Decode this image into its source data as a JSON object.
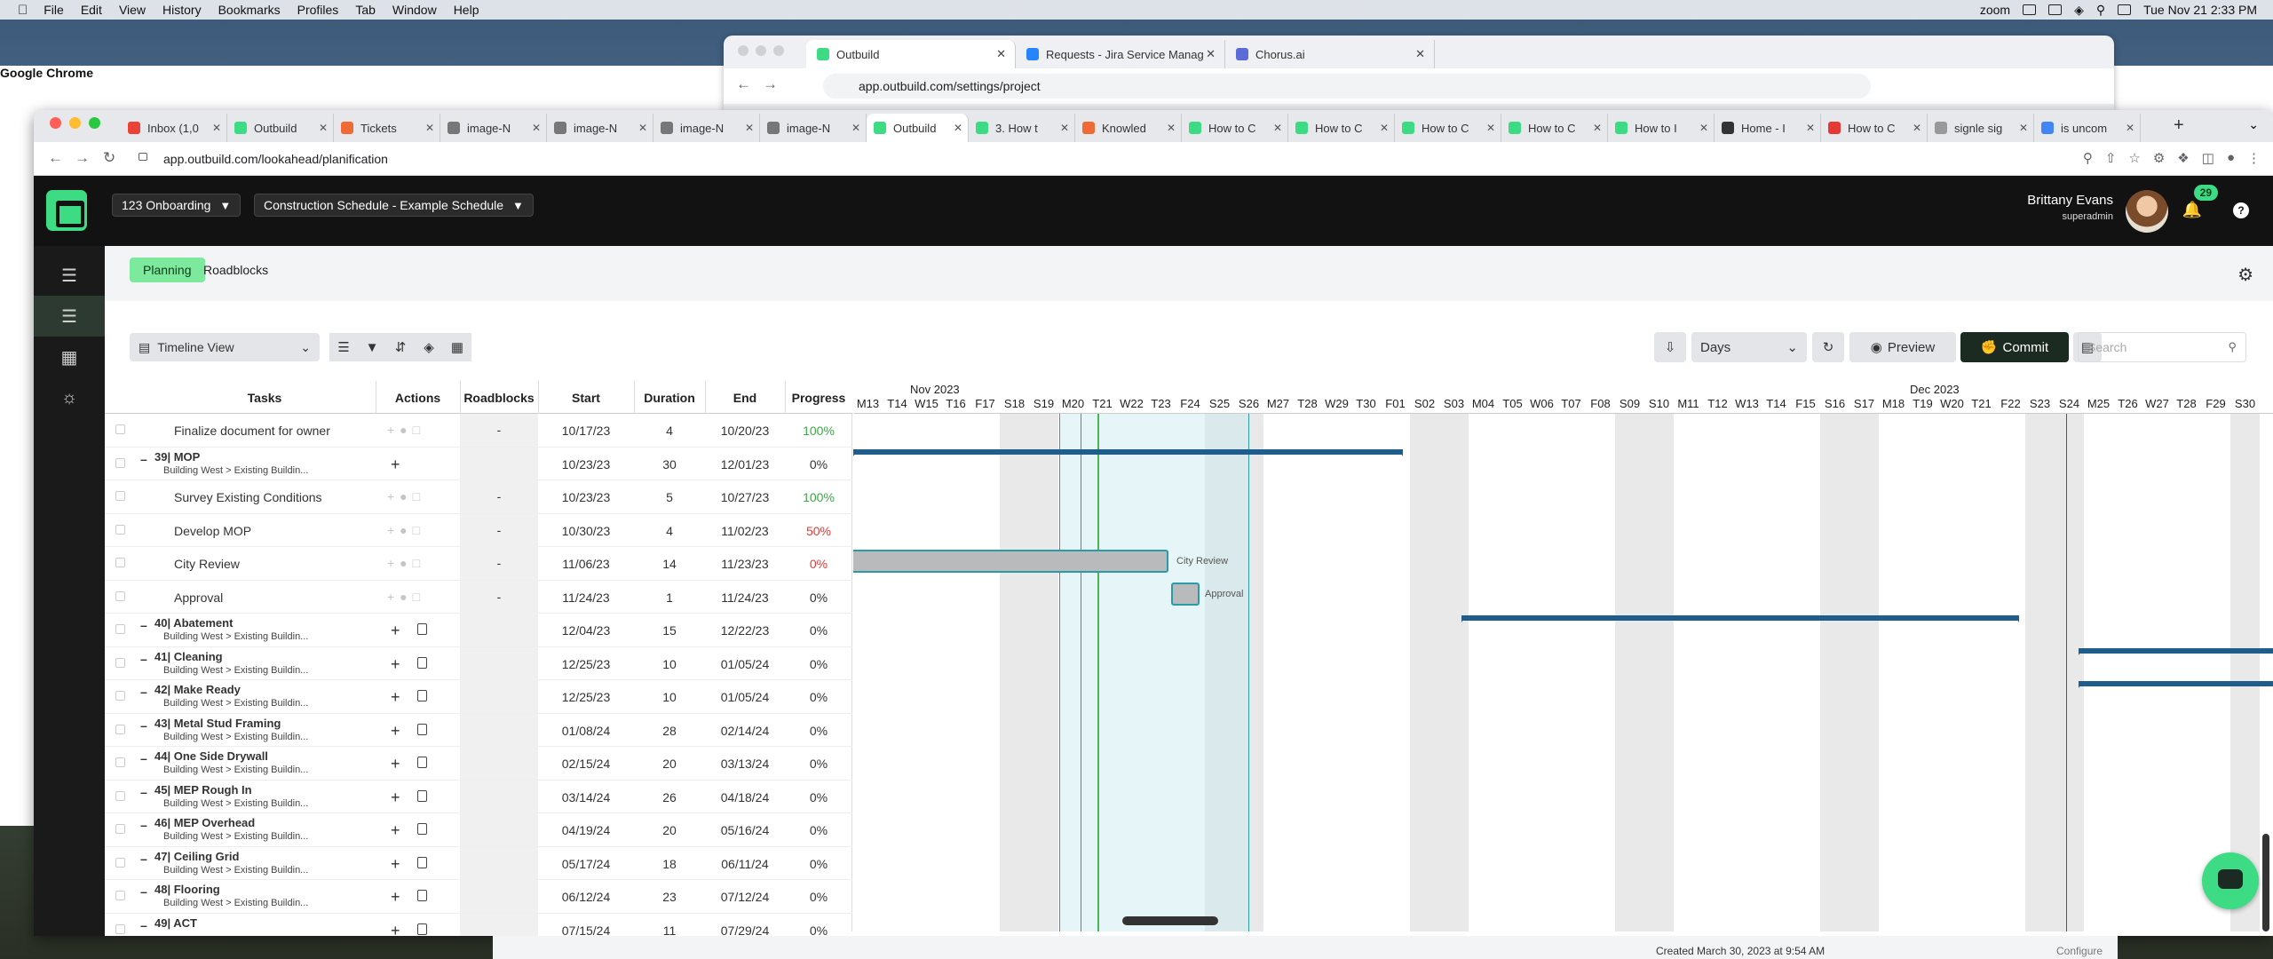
{
  "mac_menu": {
    "app": "Google Chrome",
    "items": [
      "File",
      "Edit",
      "View",
      "History",
      "Bookmarks",
      "Profiles",
      "Tab",
      "Window",
      "Help"
    ],
    "zoom": "zoom",
    "datetime": "Tue Nov 21  2:33 PM"
  },
  "back_window": {
    "tabs": [
      {
        "label": "Outbuild",
        "icon_color": "#3ddc84"
      },
      {
        "label": "Requests - Jira Service Manag",
        "icon_color": "#2684ff"
      },
      {
        "label": "Chorus.ai",
        "icon_color": "#5b6bd8"
      }
    ],
    "url": "app.outbuild.com/settings/project"
  },
  "front_window": {
    "tabs": [
      {
        "label": "Inbox (1,0",
        "icon_color": "#ea4335"
      },
      {
        "label": "Outbuild",
        "icon_color": "#3ddc84"
      },
      {
        "label": "Tickets",
        "icon_color": "#f06a35"
      },
      {
        "label": "image-N",
        "icon_color": "#777"
      },
      {
        "label": "image-N",
        "icon_color": "#777"
      },
      {
        "label": "image-N",
        "icon_color": "#777"
      },
      {
        "label": "image-N",
        "icon_color": "#777"
      },
      {
        "label": "Outbuild",
        "icon_color": "#3ddc84",
        "active": true
      },
      {
        "label": "3. How t",
        "icon_color": "#3ddc84"
      },
      {
        "label": "Knowled",
        "icon_color": "#f06a35"
      },
      {
        "label": "How to C",
        "icon_color": "#3ddc84"
      },
      {
        "label": "How to C",
        "icon_color": "#3ddc84"
      },
      {
        "label": "How to C",
        "icon_color": "#3ddc84"
      },
      {
        "label": "How to C",
        "icon_color": "#3ddc84"
      },
      {
        "label": "How to I",
        "icon_color": "#3ddc84"
      },
      {
        "label": "Home - I",
        "icon_color": "#333"
      },
      {
        "label": "How to C",
        "icon_color": "#e53935"
      },
      {
        "label": "signle sig",
        "icon_color": "#999"
      },
      {
        "label": "is uncom",
        "icon_color": "#4285f4"
      }
    ],
    "url": "app.outbuild.com/lookahead/planification"
  },
  "header": {
    "project": "123 Onboarding",
    "schedule": "Construction Schedule - Example Schedule",
    "user_name": "Brittany Evans",
    "user_role": "superadmin",
    "notifications": "29"
  },
  "subtabs": {
    "planning": "Planning",
    "roadblocks": "Roadblocks"
  },
  "toolbar": {
    "view": "Timeline View",
    "scale": "Days",
    "preview": "Preview",
    "commit": "Commit",
    "search_placeholder": "Search"
  },
  "table": {
    "headers": [
      "Tasks",
      "Actions",
      "Roadblocks",
      "Start",
      "Duration",
      "End",
      "Progress"
    ],
    "rows": [
      {
        "kind": "task",
        "name": "Finalize document for owner",
        "roadblocks": "-",
        "start": "10/17/23",
        "duration": "4",
        "end": "10/20/23",
        "progress": "100%",
        "progress_color": "#3aa845"
      },
      {
        "kind": "parent",
        "name": "39| MOP",
        "path": "Building West > Existing Buildin...",
        "start": "10/23/23",
        "duration": "30",
        "end": "12/01/23",
        "progress": "0%",
        "progress_color": "#333"
      },
      {
        "kind": "task",
        "name": "Survey Existing Conditions",
        "roadblocks": "-",
        "start": "10/23/23",
        "duration": "5",
        "end": "10/27/23",
        "progress": "100%",
        "progress_color": "#3aa845"
      },
      {
        "kind": "task",
        "name": "Develop MOP",
        "roadblocks": "-",
        "start": "10/30/23",
        "duration": "4",
        "end": "11/02/23",
        "progress": "50%",
        "progress_color": "#e53935"
      },
      {
        "kind": "task",
        "name": "City Review",
        "roadblocks": "-",
        "start": "11/06/23",
        "duration": "14",
        "end": "11/23/23",
        "progress": "0%",
        "progress_color": "#e53935"
      },
      {
        "kind": "task",
        "name": "Approval",
        "roadblocks": "-",
        "start": "11/24/23",
        "duration": "1",
        "end": "11/24/23",
        "progress": "0%",
        "progress_color": "#333"
      },
      {
        "kind": "parent",
        "name": "40| Abatement",
        "path": "Building West > Existing Buildin...",
        "start": "12/04/23",
        "duration": "15",
        "end": "12/22/23",
        "progress": "0%",
        "progress_color": "#333"
      },
      {
        "kind": "parent",
        "name": "41| Cleaning",
        "path": "Building West > Existing Buildin...",
        "start": "12/25/23",
        "duration": "10",
        "end": "01/05/24",
        "progress": "0%",
        "progress_color": "#333"
      },
      {
        "kind": "parent",
        "name": "42| Make Ready",
        "path": "Building West > Existing Buildin...",
        "start": "12/25/23",
        "duration": "10",
        "end": "01/05/24",
        "progress": "0%",
        "progress_color": "#333"
      },
      {
        "kind": "parent",
        "name": "43| Metal Stud Framing",
        "path": "Building West > Existing Buildin...",
        "start": "01/08/24",
        "duration": "28",
        "end": "02/14/24",
        "progress": "0%",
        "progress_color": "#333"
      },
      {
        "kind": "parent",
        "name": "44| One Side Drywall",
        "path": "Building West > Existing Buildin...",
        "start": "02/15/24",
        "duration": "20",
        "end": "03/13/24",
        "progress": "0%",
        "progress_color": "#333"
      },
      {
        "kind": "parent",
        "name": "45| MEP Rough In",
        "path": "Building West > Existing Buildin...",
        "start": "03/14/24",
        "duration": "26",
        "end": "04/18/24",
        "progress": "0%",
        "progress_color": "#333"
      },
      {
        "kind": "parent",
        "name": "46| MEP Overhead",
        "path": "Building West > Existing Buildin...",
        "start": "04/19/24",
        "duration": "20",
        "end": "05/16/24",
        "progress": "0%",
        "progress_color": "#333"
      },
      {
        "kind": "parent",
        "name": "47| Ceiling Grid",
        "path": "Building West > Existing Buildin...",
        "start": "05/17/24",
        "duration": "18",
        "end": "06/11/24",
        "progress": "0%",
        "progress_color": "#333"
      },
      {
        "kind": "parent",
        "name": "48| Flooring",
        "path": "Building West > Existing Buildin...",
        "start": "06/12/24",
        "duration": "23",
        "end": "07/12/24",
        "progress": "0%",
        "progress_color": "#333"
      },
      {
        "kind": "parent",
        "name": "49| ACT",
        "path": "",
        "start": "07/15/24",
        "duration": "11",
        "end": "07/29/24",
        "progress": "0%",
        "progress_color": "#333"
      }
    ]
  },
  "gantt": {
    "months": [
      {
        "label": "Nov 2023"
      },
      {
        "label": "Dec 2023"
      }
    ],
    "days": [
      "M13",
      "T14",
      "W15",
      "T16",
      "F17",
      "S18",
      "S19",
      "M20",
      "T21",
      "W22",
      "T23",
      "F24",
      "S25",
      "S26",
      "M27",
      "T28",
      "W29",
      "T30",
      "F01",
      "S02",
      "S03",
      "M04",
      "T05",
      "W06",
      "T07",
      "F08",
      "S09",
      "S10",
      "M11",
      "T12",
      "W13",
      "T14",
      "F15",
      "S16",
      "S17",
      "M18",
      "T19",
      "W20",
      "T21",
      "F22",
      "S23",
      "S24",
      "M25",
      "T26",
      "W27",
      "T28",
      "F29",
      "S30"
    ],
    "labels": {
      "city_review": "City Review",
      "approval": "Approval"
    }
  },
  "footer": {
    "created": "Created March 30, 2023 at 9:54 AM",
    "configure": "Configure"
  }
}
